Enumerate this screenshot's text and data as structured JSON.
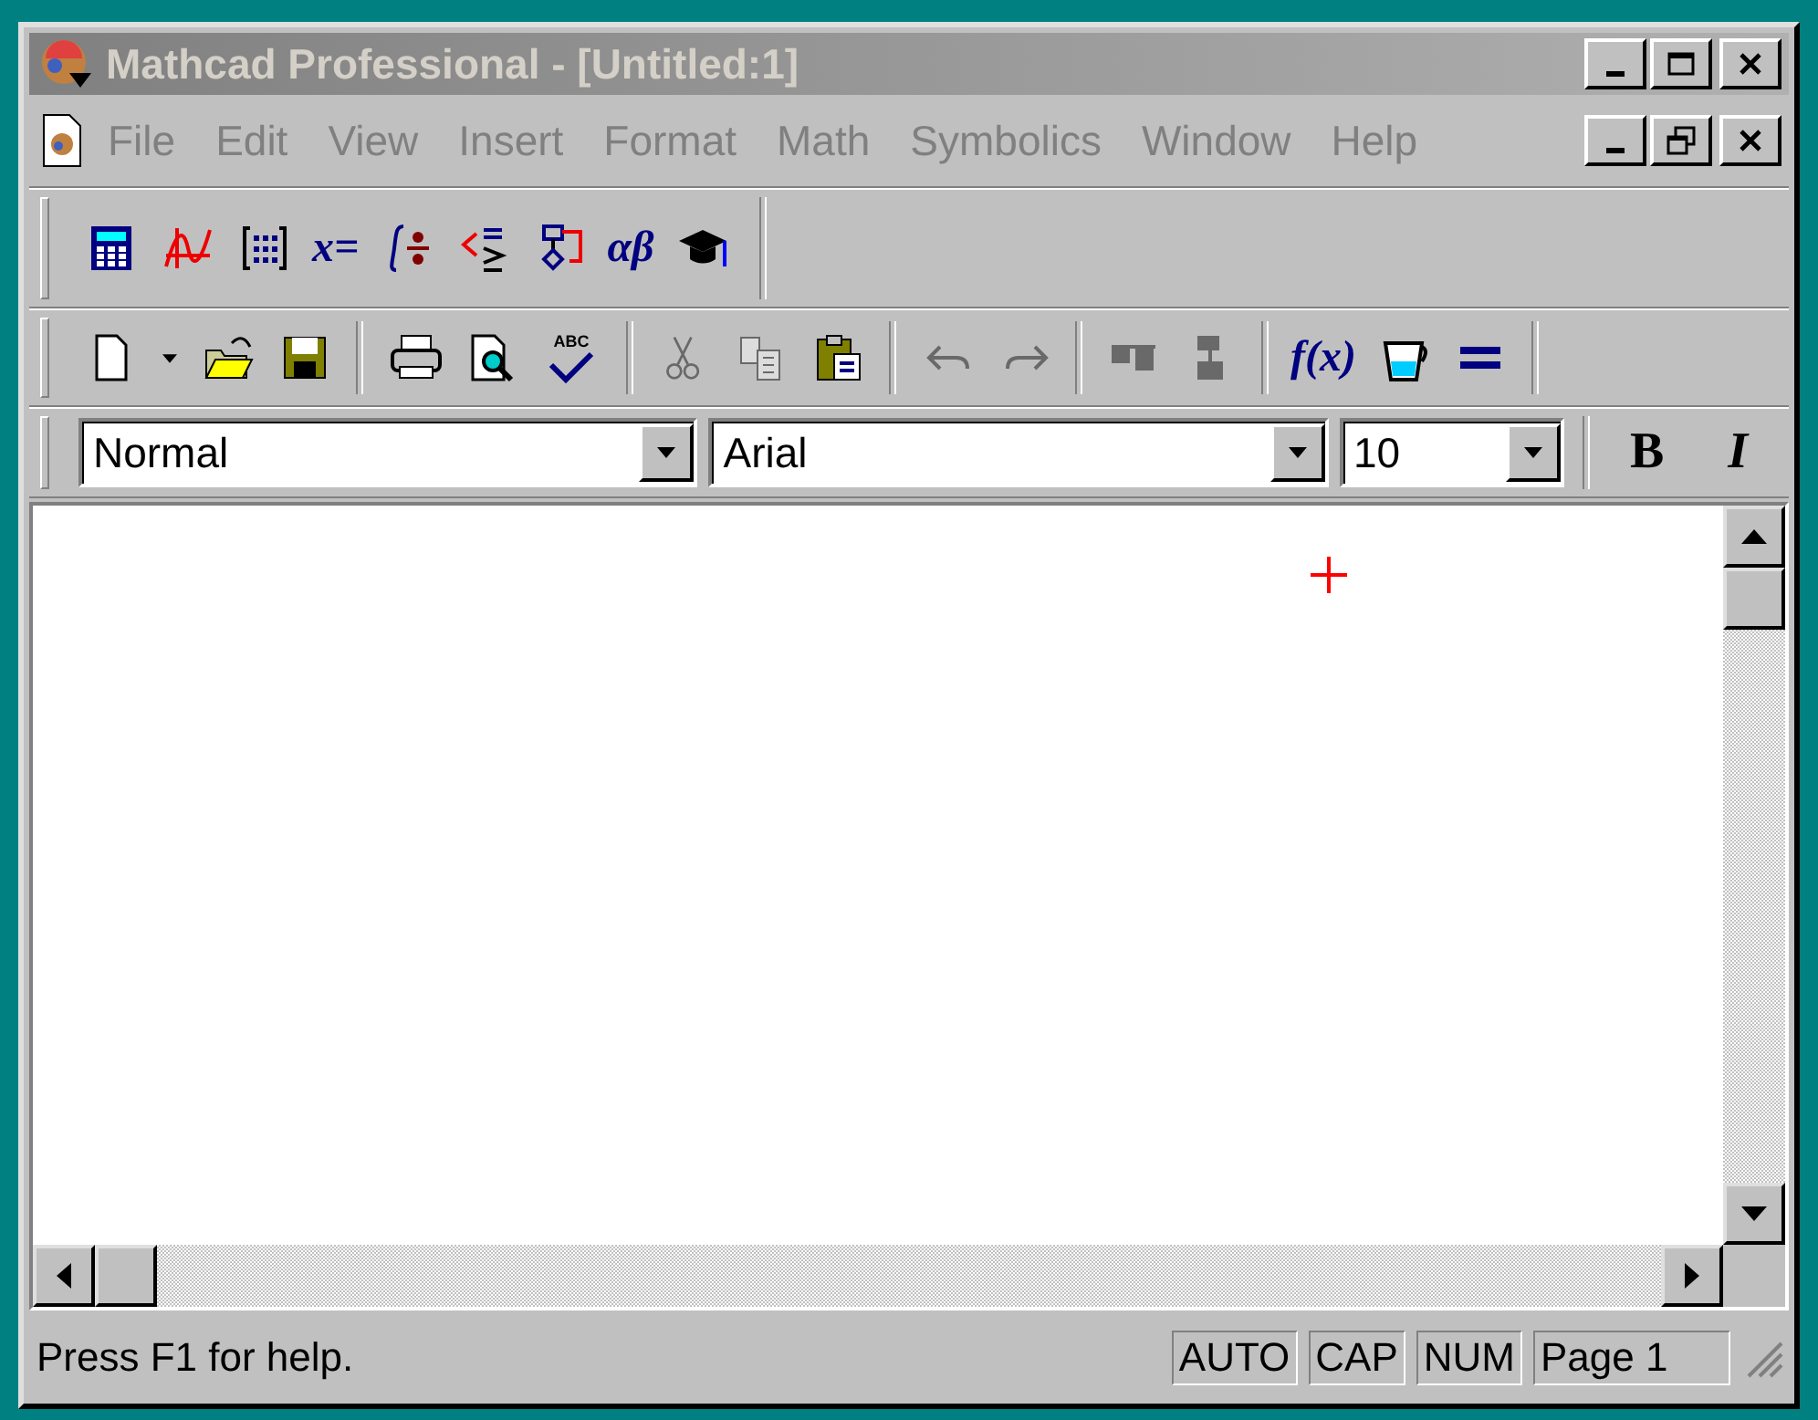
{
  "window": {
    "title": "Mathcad Professional - [Untitled:1]",
    "active": false
  },
  "menu": [
    {
      "label": "File"
    },
    {
      "label": "Edit"
    },
    {
      "label": "View"
    },
    {
      "label": "Insert"
    },
    {
      "label": "Format"
    },
    {
      "label": "Math"
    },
    {
      "label": "Symbolics"
    },
    {
      "label": "Window"
    },
    {
      "label": "Help"
    }
  ],
  "math_toolbar": [
    {
      "kind": "icon"
    },
    {
      "kind": "icon"
    },
    {
      "kind": "icon"
    },
    {
      "kind": "text",
      "label": "x="
    },
    {
      "kind": "icon"
    },
    {
      "kind": "icon"
    },
    {
      "kind": "icon"
    },
    {
      "kind": "text",
      "label": "αβ"
    },
    {
      "kind": "icon"
    }
  ],
  "standard_toolbar": [
    {
      "kind": "icon",
      "disabled": false
    },
    {
      "kind": "caret",
      "disabled": false
    },
    {
      "kind": "icon",
      "disabled": false
    },
    {
      "kind": "icon",
      "disabled": false
    },
    {
      "kind": "separator"
    },
    {
      "kind": "icon",
      "disabled": false
    },
    {
      "kind": "icon",
      "disabled": false
    },
    {
      "kind": "labeled-icon",
      "label": "ABC",
      "disabled": false
    },
    {
      "kind": "separator"
    },
    {
      "kind": "icon",
      "disabled": true
    },
    {
      "kind": "icon",
      "disabled": true
    },
    {
      "kind": "icon",
      "disabled": false
    },
    {
      "kind": "separator"
    },
    {
      "kind": "icon",
      "disabled": true
    },
    {
      "kind": "icon",
      "disabled": true
    },
    {
      "kind": "separator"
    },
    {
      "kind": "icon",
      "disabled": true
    },
    {
      "kind": "icon",
      "disabled": true
    },
    {
      "kind": "separator"
    },
    {
      "kind": "text",
      "label": "f(x)",
      "disabled": false
    },
    {
      "kind": "icon",
      "disabled": false
    },
    {
      "kind": "icon",
      "disabled": false
    }
  ],
  "format_toolbar": {
    "style": "Normal",
    "font": "Arial",
    "size": "10",
    "bold": "B",
    "italic": "I"
  },
  "status_bar": {
    "message": "Press F1 for help.",
    "indicators": [
      "AUTO",
      "CAP",
      "NUM",
      "Page 1"
    ]
  }
}
